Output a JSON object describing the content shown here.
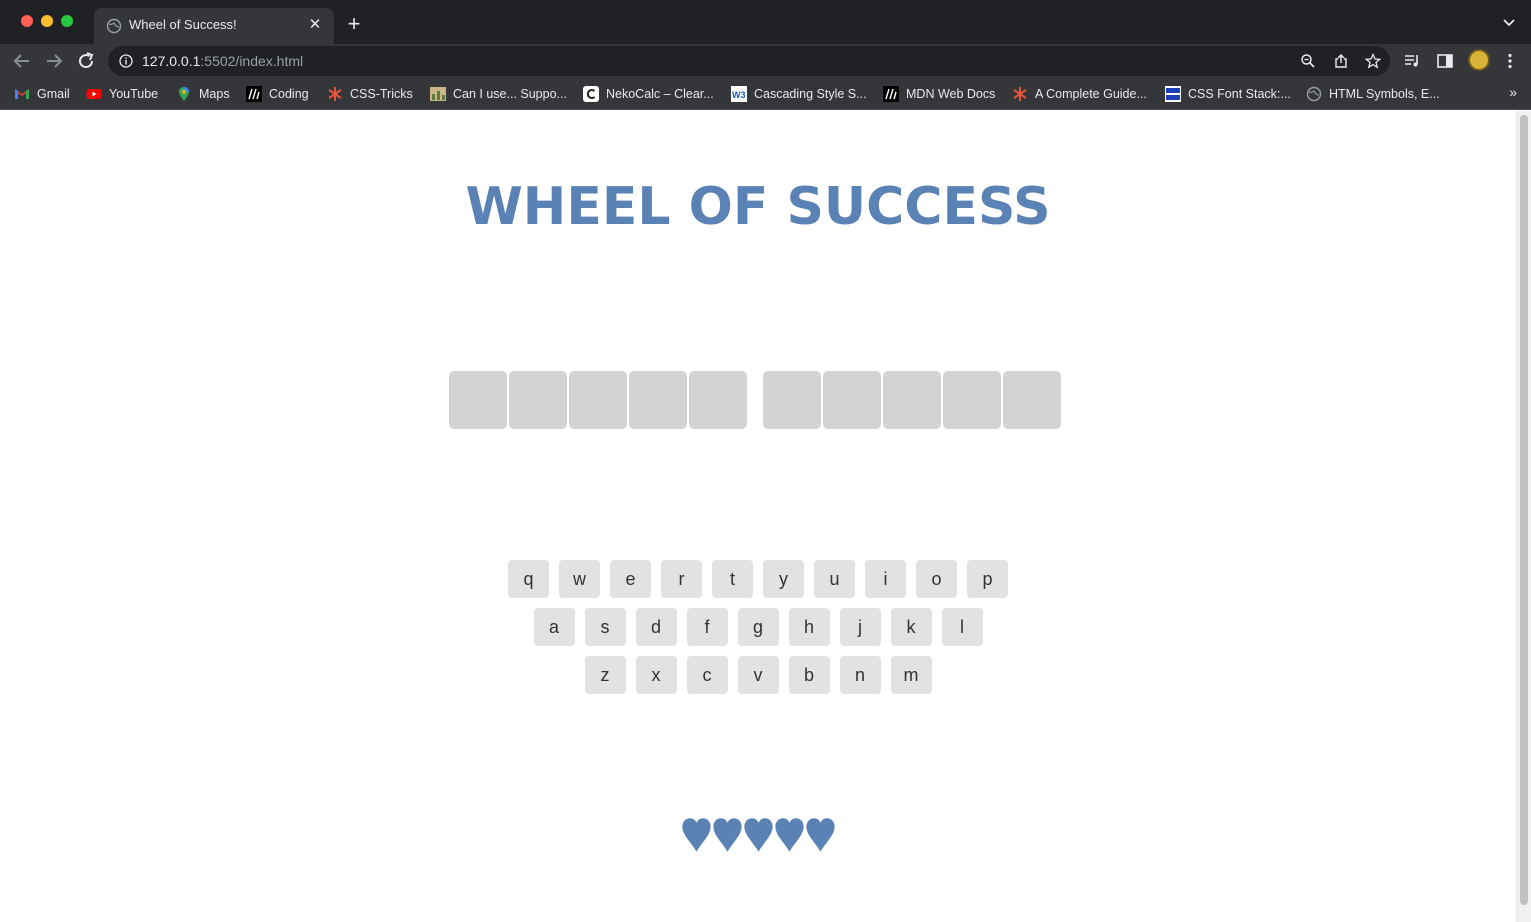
{
  "browser": {
    "tab_title": "Wheel of Success!",
    "url_host": "127.0.0.1",
    "url_rest": ":5502/index.html",
    "bookmarks": [
      {
        "label": "Gmail",
        "icon": "gmail-icon"
      },
      {
        "label": "YouTube",
        "icon": "youtube-icon"
      },
      {
        "label": "Maps",
        "icon": "maps-icon"
      },
      {
        "label": "Coding",
        "icon": "m-icon"
      },
      {
        "label": "CSS-Tricks",
        "icon": "css-tricks-icon"
      },
      {
        "label": "Can I use... Suppo...",
        "icon": "caniuse-icon"
      },
      {
        "label": "NekoCalc – Clear...",
        "icon": "nekocalc-icon"
      },
      {
        "label": "Cascading Style S...",
        "icon": "w3-icon"
      },
      {
        "label": "MDN Web Docs",
        "icon": "mdn-icon"
      },
      {
        "label": "A Complete Guide...",
        "icon": "css-tricks-icon"
      },
      {
        "label": "CSS Font Stack:...",
        "icon": "cssfontstack-icon"
      },
      {
        "label": "HTML Symbols, E...",
        "icon": "globe-icon"
      }
    ]
  },
  "game": {
    "title": "WHEEL OF SUCCESS",
    "phrase_words": [
      5,
      5
    ],
    "keyboard_rows": [
      [
        "q",
        "w",
        "e",
        "r",
        "t",
        "y",
        "u",
        "i",
        "o",
        "p"
      ],
      [
        "a",
        "s",
        "d",
        "f",
        "g",
        "h",
        "j",
        "k",
        "l"
      ],
      [
        "z",
        "x",
        "c",
        "v",
        "b",
        "n",
        "m"
      ]
    ],
    "lives": 5,
    "heart_color": "#5b82b4",
    "tile_color": "#d3d3d3",
    "key_color": "#e2e2e2"
  }
}
